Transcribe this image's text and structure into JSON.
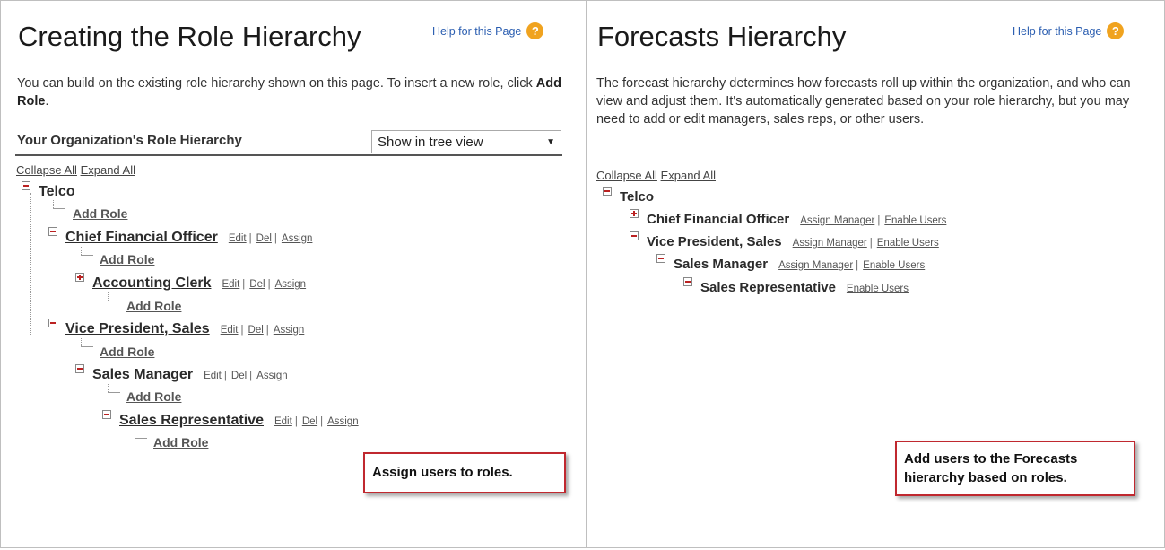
{
  "left": {
    "title": "Creating the Role Hierarchy",
    "help_label": "Help for this Page",
    "intro_text": "You can build on the existing role hierarchy shown on this page. To insert a new role, click ",
    "intro_bold": "Add Role",
    "intro_end": ".",
    "section_header": "Your Organization's Role Hierarchy",
    "view_select": "Show in tree view",
    "collapse_all": "Collapse All",
    "expand_all": "Expand All",
    "root": "Telco",
    "add_role": "Add Role",
    "edit": "Edit",
    "del": "Del",
    "assign": "Assign",
    "sep": "|",
    "roles": {
      "cfo": "Chief Financial Officer",
      "clerk": "Accounting Clerk",
      "vp": "Vice President, Sales",
      "mgr": "Sales Manager",
      "rep": "Sales Representative"
    },
    "callout": "Assign users to roles."
  },
  "right": {
    "title": "Forecasts Hierarchy",
    "help_label": "Help for this Page",
    "intro_text": "The forecast hierarchy determines how forecasts roll up within the organization, and who can view and adjust them. It's automatically generated based on your role hierarchy, but you may need to add or edit managers, sales reps, or other users.",
    "collapse_all": "Collapse All",
    "expand_all": "Expand All",
    "root": "Telco",
    "assign_manager": "Assign Manager",
    "enable_users": "Enable Users",
    "sep": "|",
    "roles": {
      "cfo": "Chief Financial Officer",
      "vp": "Vice President, Sales",
      "mgr": "Sales Manager",
      "rep": "Sales Representative"
    },
    "callout": "Add users to the Forecasts hierarchy based on roles."
  },
  "colors": {
    "link": "#2a5db0",
    "help_icon": "#f0a31f",
    "callout_border": "#c0282f",
    "toggle": "#b22222"
  },
  "icons": {
    "help": "question-circle-icon",
    "collapse": "minus-box-icon",
    "expand": "plus-box-icon"
  }
}
